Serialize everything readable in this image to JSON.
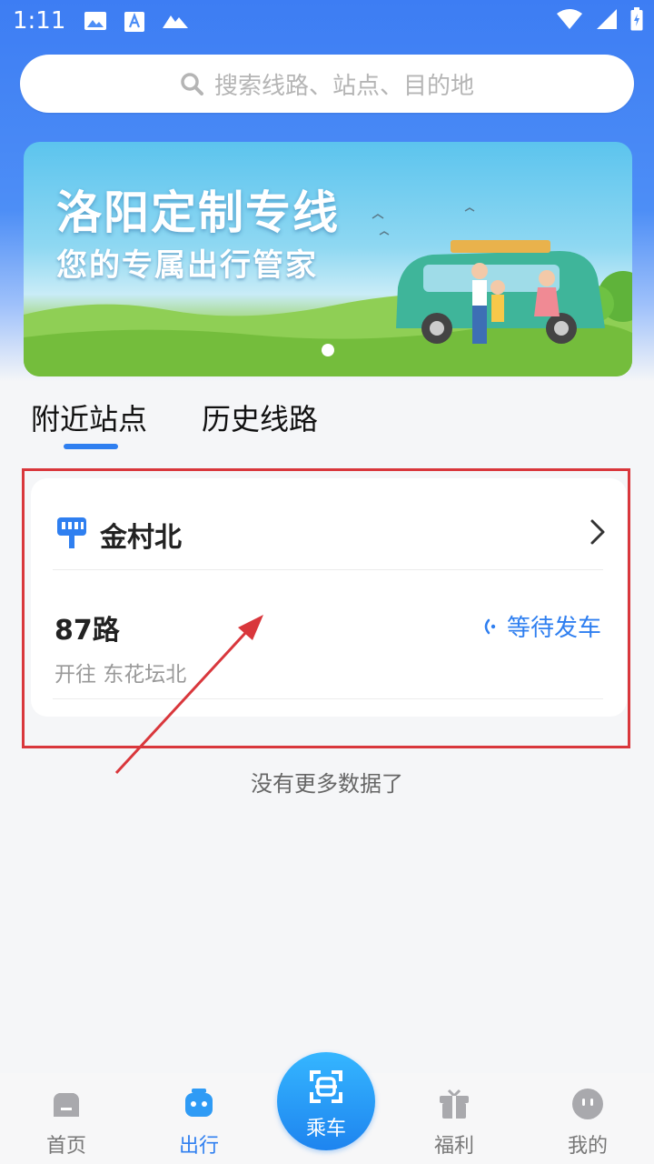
{
  "status_bar": {
    "time": "1:11"
  },
  "search": {
    "placeholder": "搜索线路、站点、目的地"
  },
  "banner": {
    "title": "洛阳定制专线",
    "subtitle": "您的专属出行管家"
  },
  "tabs": [
    {
      "label": "附近站点",
      "selected": true
    },
    {
      "label": "历史线路",
      "selected": false
    }
  ],
  "station": {
    "name": "金村北",
    "routes": [
      {
        "name": "87路",
        "destination": "开往 东花坛北",
        "status": "等待发车"
      }
    ]
  },
  "no_more_text": "没有更多数据了",
  "bottom_nav": {
    "home": "首页",
    "travel": "出行",
    "ride": "乘车",
    "welfare": "福利",
    "mine": "我的"
  },
  "colors": {
    "accent": "#2f7ff0",
    "annotation": "#d9373c"
  }
}
